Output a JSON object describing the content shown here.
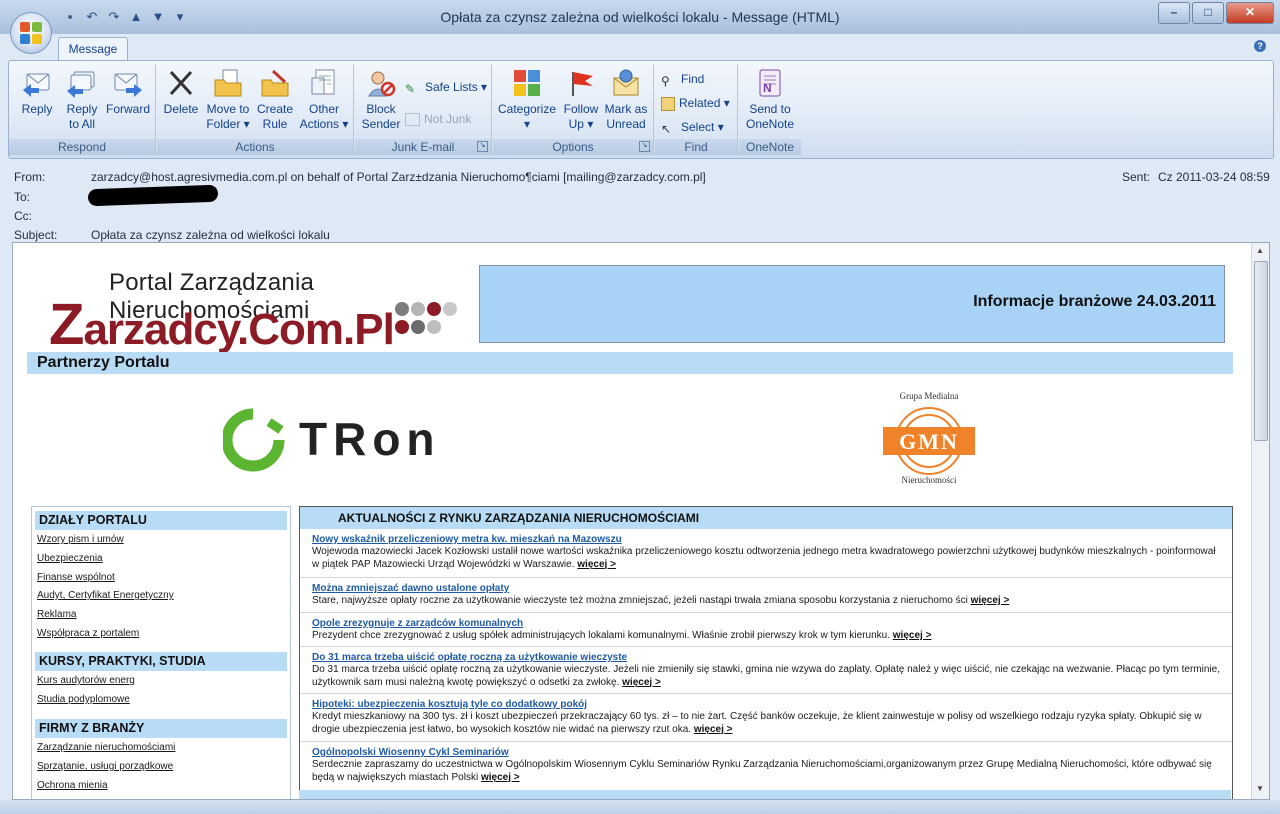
{
  "window": {
    "title": "Opłata za czynsz zależna od wielkości lokalu - Message (HTML)"
  },
  "tabs": [
    {
      "label": "Message"
    }
  ],
  "ribbon": {
    "respond": {
      "label": "Respond",
      "reply": "Reply",
      "reply_all_1": "Reply",
      "reply_all_2": "to All",
      "forward": "Forward"
    },
    "actions": {
      "label": "Actions",
      "delete": "Delete",
      "move_1": "Move to",
      "move_2": "Folder",
      "create_1": "Create",
      "create_2": "Rule",
      "other_1": "Other",
      "other_2": "Actions"
    },
    "junk": {
      "label": "Junk E-mail",
      "block_1": "Block",
      "block_2": "Sender",
      "safe_lists": "Safe Lists",
      "not_junk": "Not Junk"
    },
    "options": {
      "label": "Options",
      "categorize": "Categorize",
      "follow_1": "Follow",
      "follow_2": "Up",
      "mark_1": "Mark as",
      "mark_2": "Unread"
    },
    "find": {
      "label": "Find",
      "find": "Find",
      "related": "Related",
      "select": "Select"
    },
    "onenote": {
      "label": "OneNote",
      "send_1": "Send to",
      "send_2": "OneNote"
    }
  },
  "header": {
    "from_label": "From:",
    "from_value": "zarzadcy@host.agresivmedia.com.pl on behalf of Portal Zarz±dzania Nieruchomo¶ciami [mailing@zarzadcy.com.pl]",
    "to_label": "To:",
    "cc_label": "Cc:",
    "subject_label": "Subject:",
    "subject_value": "Opłata za czynsz zależna od wielkości lokalu",
    "sent_label": "Sent:",
    "sent_value": "Cz 2011-03-24 08:59"
  },
  "newsletter": {
    "logo_tagline": "Portal Zarządzania Nieruchomościami",
    "logo_first": "Z",
    "logo_rest": "arzadcy.Com.Pl",
    "banner": "Informacje branżowe 24.03.2011",
    "partners": "Partnerzy Portalu",
    "tron_text": "TRon",
    "gmn_top": "Grupa Medialna",
    "gmn_mid": "GMN",
    "gmn_bottom": "Nieruchomości",
    "left": {
      "s1": "DZIAŁY PORTALU",
      "s1_links": [
        "Wzory pism i umów",
        "Ubezpieczenia",
        "Finanse wspólnot",
        "Audyt, Certyfikat Energetyczny",
        "Reklama",
        "Współpraca z portalem"
      ],
      "s2": "KURSY, PRAKTYKI, STUDIA",
      "s2_links": [
        "Kurs audytorów energ",
        "Studia podyplomowe"
      ],
      "s3": "FIRMY Z BRANŻY",
      "s3_links": [
        "Zarządzanie nieruchomościami",
        "Sprzątanie, usługi porządkowe",
        "Ochrona mienia"
      ]
    },
    "news_heading": "AKTUALNOŚCI Z RYNKU ZARZĄDZANIA NIERUCHOMOŚCIAMI",
    "more": "więcej >",
    "news": [
      {
        "title": "Nowy wskaźnik przeliczeniowy metra kw. mieszkań na Mazowszu",
        "text": "Wojewoda mazowiecki Jacek Kozłowski ustalił nowe wartości wskaźnika przeliczeniowego kosztu odtworzenia jednego metra kwadratowego powierzchni użytkowej budynków mieszkalnych - poinformował w piątek PAP Mazowiecki Urząd Wojewódzki w Warszawie."
      },
      {
        "title": "Można zmniejszać dawno ustalone opłaty",
        "text": "Stare, najwyższe opłaty roczne za użytkowanie wieczyste też można zmniejszać, jeżeli nastąpi trwała zmiana sposobu korzystania z nieruchomo ści"
      },
      {
        "title": "Opole zrezygnuje z zarządców komunalnych",
        "text": "Prezydent chce zrezygnować z usług spółek administrujących lokalami komunalnymi. Właśnie zrobił pierwszy krok w tym kierunku."
      },
      {
        "title": "Do 31 marca trzeba uiścić opłatę roczną za użytkowanie wieczyste",
        "text": "Do 31 marca trzeba uiścić opłatę roczną za użytkowanie wieczyste. Jeżeli nie zmieniły się stawki, gmina nie wzywa do zapłaty. Opłatę należ y więc uiścić, nie czekając na wezwanie. Płacąc po tym terminie, użytkownik sam musi należną kwotę powiększyć o odsetki za zwłokę."
      },
      {
        "title": "Hipoteki: ubezpieczenia kosztują tyle co dodatkowy pokój",
        "text": "Kredyt mieszkaniowy na 300 tys. zł i koszt ubezpieczeń przekraczający 60 tys. zł – to nie żart. Część banków oczekuje, że klient zainwestuje w polisy od wszelkiego rodzaju ryzyka spłaty. Obkupić się w drogie ubezpieczenia jest łatwo, bo wysokich kosztów nie widać na pierwszy rzut oka."
      },
      {
        "title": "Ogólnopolski Wiosenny Cykl Seminariów",
        "text": "Serdecznie zapraszamy do uczestnictwa w Ogólnopolskim Wiosennym Cyklu Seminariów Rynku Zarządzania Nieruchomościami,organizowanym przez Grupę Medialną Nieruchomości, które odbywać się będą w największych miastach Polski"
      }
    ]
  },
  "colors": {
    "accent": "#15428b",
    "banner": "#a8d3f6",
    "logo_red": "#8c1b26",
    "link_blue": "#1f5ba5"
  }
}
